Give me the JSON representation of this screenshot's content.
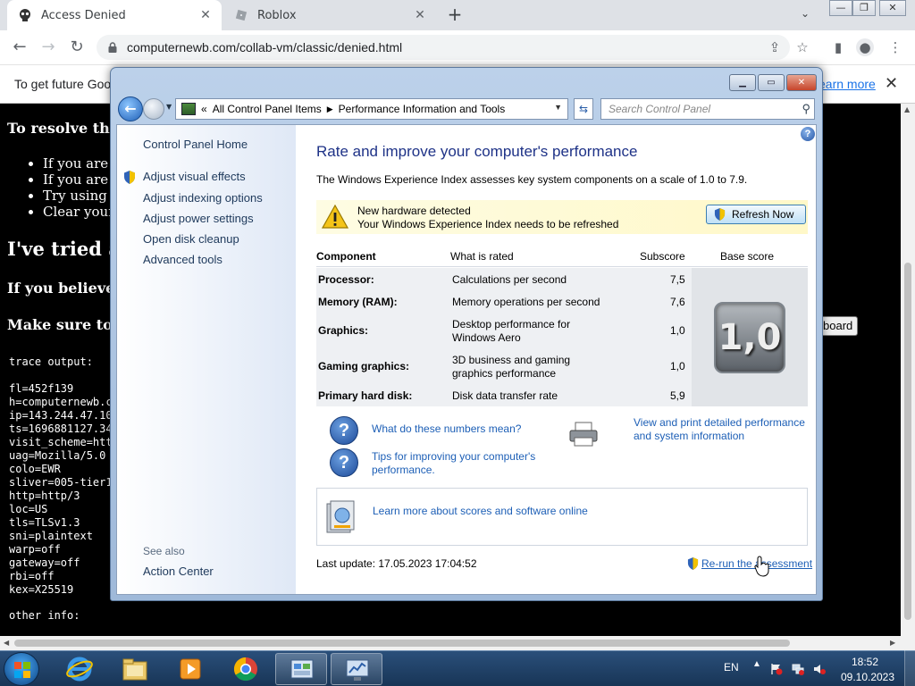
{
  "browser": {
    "tabs": [
      {
        "title": "Access Denied",
        "active": true
      },
      {
        "title": "Roblox",
        "active": false
      }
    ],
    "url": "computernewb.com/collab-vm/classic/denied.html",
    "infobar": {
      "message": "To get future Goog",
      "link": "earn more"
    }
  },
  "page": {
    "resolve_heading": "To resolve this",
    "bullets": [
      "If you are u",
      "If you are u",
      "Try using y",
      "Clear your b"
    ],
    "tried_heading": "I've tried al",
    "believe_heading": "If you believe t",
    "make_sure_heading": "Make sure to p",
    "clipboard_button": "board",
    "trace_label": "trace output:",
    "trace_lines": [
      "fl=452f139",
      "h=computernewb.c",
      "ip=143.244.47.10",
      "ts=1696881127.34",
      "visit_scheme=htt",
      "uag=Mozilla/5.0",
      "colo=EWR",
      "sliver=005-tier1",
      "http=http/3",
      "loc=US",
      "tls=TLSv1.3",
      "sni=plaintext",
      "warp=off",
      "gateway=off",
      "rbi=off",
      "kex=X25519"
    ],
    "other_label": "other info:"
  },
  "dialog": {
    "breadcrumb": [
      "All Control Panel Items",
      "Performance Information and Tools"
    ],
    "search_placeholder": "Search Control Panel",
    "sidebar": {
      "home": "Control Panel Home",
      "links": [
        "Adjust visual effects",
        "Adjust indexing options",
        "Adjust power settings",
        "Open disk cleanup",
        "Advanced tools"
      ],
      "see_also": "See also",
      "action_center": "Action Center"
    },
    "heading": "Rate and improve your computer's performance",
    "intro": "The Windows Experience Index assesses key system components on a scale of 1.0 to 7.9.",
    "alert": {
      "line1": "New hardware detected",
      "line2": "Your Windows Experience Index needs to be refreshed",
      "button": "Refresh Now"
    },
    "table": {
      "headers": {
        "component": "Component",
        "rated": "What is rated",
        "subscore": "Subscore",
        "base": "Base score"
      },
      "rows": [
        {
          "component": "Processor:",
          "rated": "Calculations per second",
          "subscore": "7,5"
        },
        {
          "component": "Memory (RAM):",
          "rated": "Memory operations per second",
          "subscore": "7,6"
        },
        {
          "component": "Graphics:",
          "rated": "Desktop performance for Windows Aero",
          "subscore": "1,0"
        },
        {
          "component": "Gaming graphics:",
          "rated": "3D business and gaming graphics performance",
          "subscore": "1,0"
        },
        {
          "component": "Primary hard disk:",
          "rated": "Disk data transfer rate",
          "subscore": "5,9"
        }
      ],
      "base_score": "1,0"
    },
    "links": {
      "numbers": "What do these numbers mean?",
      "tips": "Tips for improving your computer's performance.",
      "print": "View and print detailed performance and system information",
      "learn": "Learn more about scores and software online"
    },
    "last_update": "Last update: 17.05.2023 17:04:52",
    "rerun": "Re-run the assessment"
  },
  "taskbar": {
    "language": "EN",
    "time": "18:52",
    "date": "09.10.2023"
  }
}
